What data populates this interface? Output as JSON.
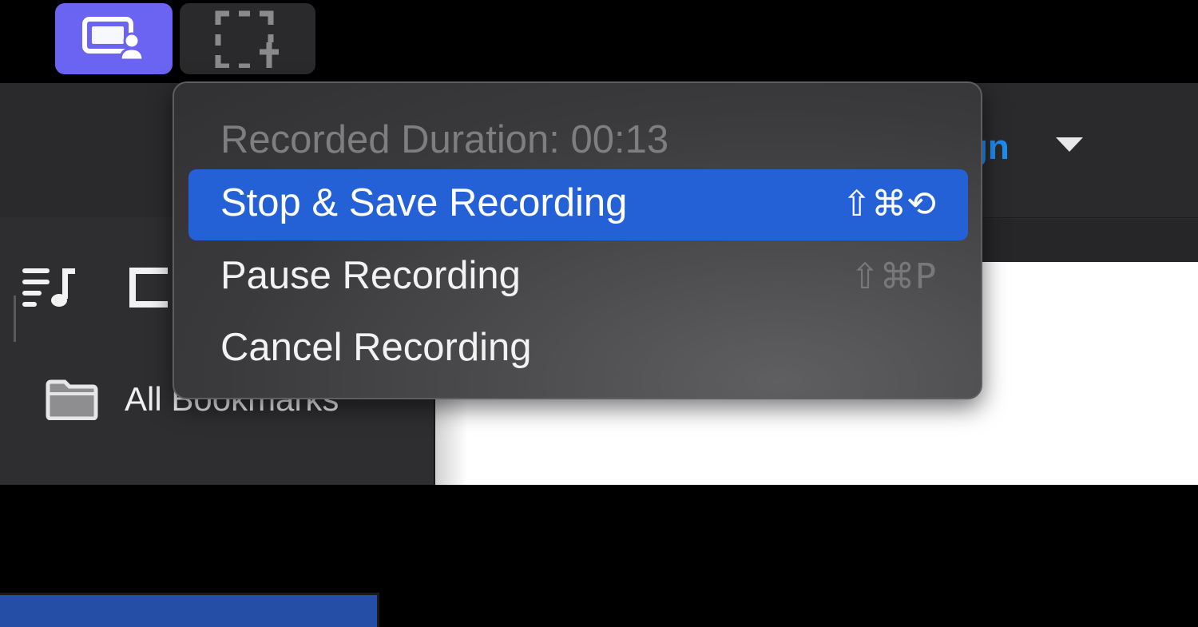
{
  "menubar": {
    "record_button": {
      "icon": "screen-record-user-icon",
      "accent": "#6b63f2"
    },
    "region_button": {
      "icon": "region-select-plus-icon"
    }
  },
  "app": {
    "toolbar_partial_text": "gn",
    "sidebar": {
      "section_label": "All Bookmarks"
    }
  },
  "menu": {
    "info_label": "Recorded Duration: 00:13",
    "items": [
      {
        "label": "Stop & Save Recording",
        "shortcut": "⇧⌘⟲",
        "highlighted": true
      },
      {
        "label": "Pause Recording",
        "shortcut": "⇧⌘P",
        "enabled_shortcut": false
      },
      {
        "label": "Cancel Recording",
        "shortcut": ""
      }
    ],
    "highlight_color": "#2461d6"
  }
}
